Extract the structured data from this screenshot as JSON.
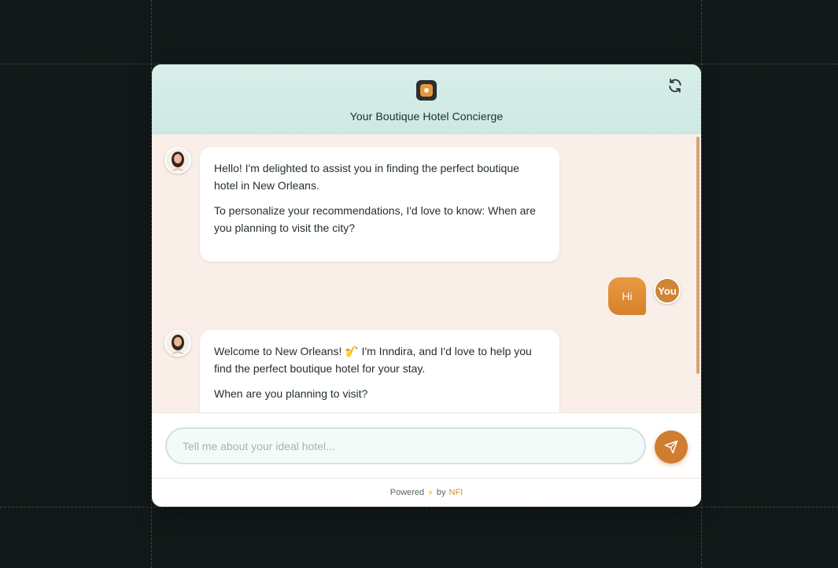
{
  "header": {
    "title": "Your Boutique Hotel Concierge",
    "logo_icon": "hotel-logo-icon",
    "refresh_icon": "refresh-icon"
  },
  "messages": [
    {
      "role": "assistant",
      "paragraphs": [
        "Hello! I'm delighted to assist you in finding the perfect boutique hotel in New Orleans.",
        "To personalize your recommendations, I'd love to know: When are you planning to visit the city?"
      ]
    },
    {
      "role": "user",
      "text": "Hi",
      "avatar_label": "You"
    },
    {
      "role": "assistant",
      "paragraphs": [
        "Welcome to New Orleans! 🎷 I'm Inndira, and I'd love to help you find the perfect boutique hotel for your stay.",
        "When are you planning to visit?"
      ]
    }
  ],
  "input": {
    "placeholder": "Tell me about your ideal hotel...",
    "value": ""
  },
  "footer": {
    "prefix": "Powered",
    "bolt": "⚡",
    "by": "by",
    "brand": "NFI"
  },
  "colors": {
    "accent": "#d07d30",
    "header_bg": "#d4ece6",
    "chat_bg": "#f9efe8"
  }
}
